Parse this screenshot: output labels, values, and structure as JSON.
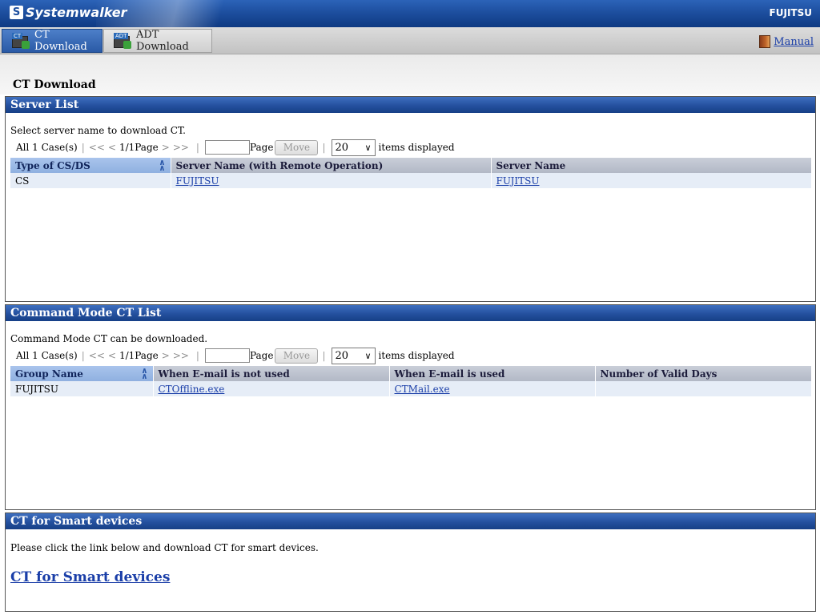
{
  "header": {
    "app_name": "Systemwalker",
    "logo_mark": "S",
    "brand": "FUJITSU"
  },
  "tabs": [
    {
      "label": "CT Download",
      "icon": "ct-download-icon",
      "badge": "CT",
      "active": true
    },
    {
      "label": "ADT Download",
      "icon": "adt-download-icon",
      "badge": "ADT",
      "active": false
    }
  ],
  "manual_link": {
    "label": "Manual",
    "icon": "manual-book-icon"
  },
  "page_title": "CT Download",
  "server_list": {
    "title": "Server List",
    "description": "Select server name to download CT.",
    "pager": {
      "count": "All 1 Case(s)",
      "first": "<<",
      "prev": "<",
      "current": "1/1Page",
      "next": ">",
      "last": ">>",
      "page_label": "Page",
      "move_label": "Move",
      "per_page": "20",
      "suffix": "items displayed"
    },
    "columns": [
      "Type of CS/DS",
      "Server Name (with Remote Operation)",
      "Server Name"
    ],
    "rows": [
      [
        "CS",
        "FUJITSU",
        "FUJITSU"
      ]
    ]
  },
  "command_list": {
    "title": "Command Mode CT List",
    "description": "Command Mode CT can be downloaded.",
    "pager": {
      "count": "All 1 Case(s)",
      "first": "<<",
      "prev": "<",
      "current": "1/1Page",
      "next": ">",
      "last": ">>",
      "page_label": "Page",
      "move_label": "Move",
      "per_page": "20",
      "suffix": "items displayed"
    },
    "columns": [
      "Group Name",
      "When E-mail is not used",
      "When E-mail is used",
      "Number of Valid Days"
    ],
    "rows": [
      [
        "FUJITSU",
        "CTOffline.exe",
        "CTMail.exe",
        ""
      ]
    ]
  },
  "smart_devices": {
    "title": "CT for Smart devices",
    "description": "Please click the link below and download CT for smart devices.",
    "link_label": "CT for Smart devices"
  },
  "colors": {
    "header_blue": "#1d4f9f",
    "link": "#1a3ea8",
    "row_bg": "#e6edf7",
    "sorted_header": "#a9c4ec"
  }
}
